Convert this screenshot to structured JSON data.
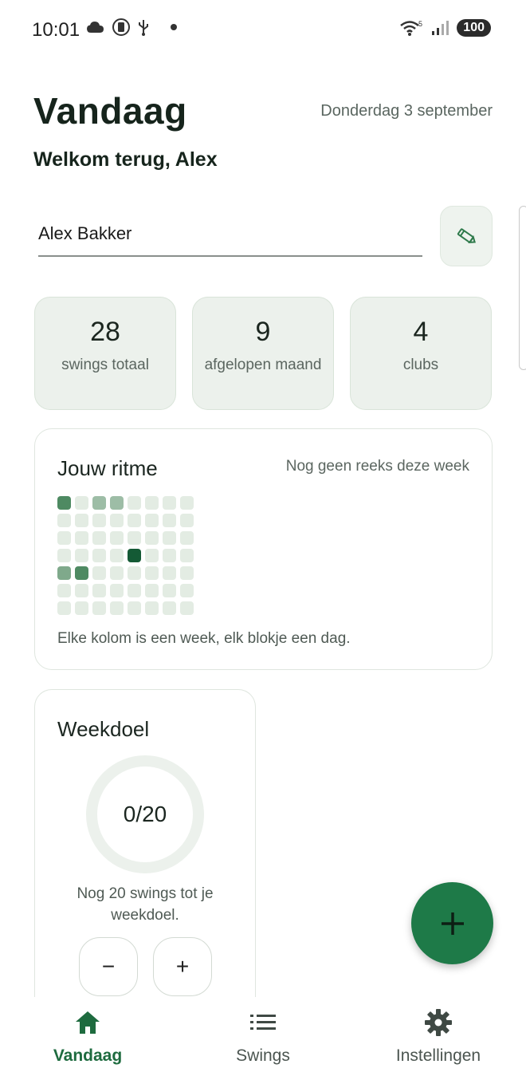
{
  "status_bar": {
    "time": "10:01",
    "battery": "100",
    "signal_label": "5"
  },
  "header": {
    "title": "Vandaag",
    "date": "Donderdag 3 september",
    "welcome": "Welkom terug, Alex"
  },
  "profile": {
    "name": "Alex Bakker",
    "edit_icon": "pencil-icon"
  },
  "stats": [
    {
      "value": "28",
      "label": "swings totaal"
    },
    {
      "value": "9",
      "label": "afgelopen maand"
    },
    {
      "value": "4",
      "label": "clubs"
    }
  ],
  "rhythm": {
    "title": "Jouw ritme",
    "status": "Nog geen reeks deze week",
    "caption": "Elke kolom is een week, elk blokje een dag.",
    "columns": 8,
    "rows": 7,
    "levels": [
      [
        3,
        0,
        1,
        1,
        0,
        0,
        0,
        0
      ],
      [
        0,
        0,
        0,
        0,
        0,
        0,
        0,
        0
      ],
      [
        0,
        0,
        0,
        0,
        0,
        0,
        0,
        0
      ],
      [
        0,
        0,
        0,
        0,
        4,
        0,
        0,
        0
      ],
      [
        2,
        3,
        0,
        0,
        0,
        0,
        0,
        0
      ],
      [
        0,
        0,
        0,
        0,
        0,
        0,
        0,
        0
      ],
      [
        0,
        0,
        0,
        0,
        0,
        0,
        0,
        0
      ]
    ],
    "colors": [
      "#e3ece3",
      "#9dbda6",
      "#7fa98b",
      "#4e8a62",
      "#145a35"
    ]
  },
  "weekgoal": {
    "title": "Weekdoel",
    "progress_text": "0/20",
    "progress_fraction": 0,
    "remaining_text": "Nog 20 swings tot je weekdoel.",
    "minus_label": "−",
    "plus_label": "+"
  },
  "fab": {
    "label": "+"
  },
  "nav": {
    "items": [
      {
        "label": "Vandaag",
        "icon": "home-icon",
        "active": true
      },
      {
        "label": "Swings",
        "icon": "list-icon",
        "active": false
      },
      {
        "label": "Instellingen",
        "icon": "gear-icon",
        "active": false
      }
    ]
  },
  "colors": {
    "accent": "#1e7a48",
    "card_bg": "#ecf1ec"
  }
}
